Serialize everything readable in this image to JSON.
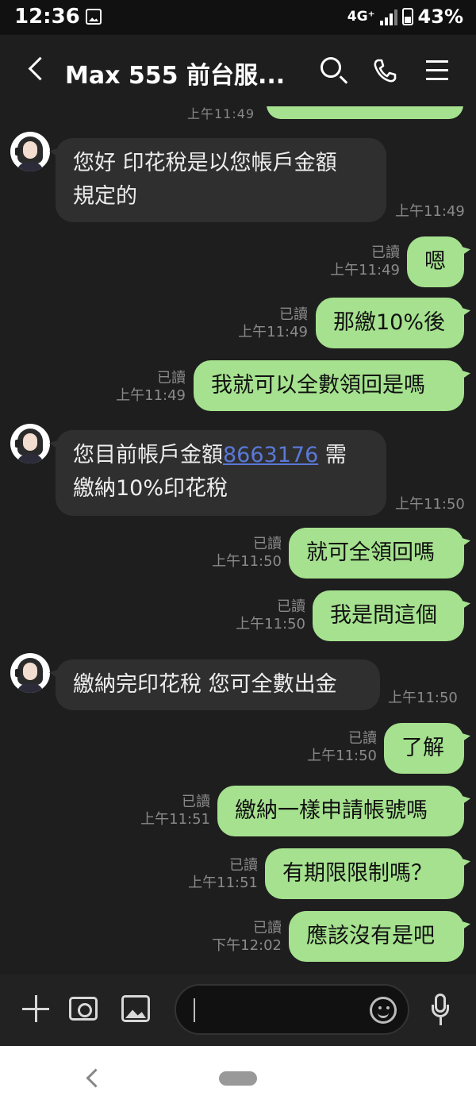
{
  "status_bar": {
    "time": "12:36",
    "network": "4G⁺",
    "battery": "43%"
  },
  "header": {
    "title": "Max 555 前台服..."
  },
  "messages": [
    {
      "id": "m1",
      "direction": "in",
      "lines": [
        "您好 印花稅是以您帳戶金額",
        "規定的"
      ],
      "time": "上午11:49"
    },
    {
      "id": "m2",
      "direction": "out",
      "text": "嗯",
      "read": "已讀",
      "time": "上午11:49"
    },
    {
      "id": "m3",
      "direction": "out",
      "text": "那繳10%後",
      "read": "已讀",
      "time": "上午11:49"
    },
    {
      "id": "m4",
      "direction": "out",
      "text": "我就可以全數領回是嗎",
      "read": "已讀",
      "time": "上午11:49"
    },
    {
      "id": "m5",
      "direction": "in",
      "line1_prefix": "您目前帳戶金額",
      "line1_link": "8663176",
      "line1_suffix": " 需",
      "line2": "繳納10%印花稅",
      "time": "上午11:50"
    },
    {
      "id": "m6",
      "direction": "out",
      "text": "就可全領回嗎",
      "read": "已讀",
      "time": "上午11:50"
    },
    {
      "id": "m7",
      "direction": "out",
      "text": "我是問這個",
      "read": "已讀",
      "time": "上午11:50"
    },
    {
      "id": "m8",
      "direction": "in",
      "text": "繳納完印花稅 您可全數出金",
      "time": "上午11:50"
    },
    {
      "id": "m9",
      "direction": "out",
      "text": "了解",
      "read": "已讀",
      "time": "上午11:50"
    },
    {
      "id": "m10",
      "direction": "out",
      "text": "繳納一樣申請帳號嗎",
      "read": "已讀",
      "time": "上午11:51"
    },
    {
      "id": "m11",
      "direction": "out",
      "text": "有期限限制嗎？",
      "read": "已讀",
      "time": "上午11:51"
    },
    {
      "id": "m12",
      "direction": "out",
      "text": "應該沒有是吧",
      "read": "已讀",
      "time": "下午12:02"
    }
  ],
  "partial_top": {
    "time": "上午11:49"
  },
  "colors": {
    "background": "#1e1e1e",
    "incoming_bubble": "#2f2f2f",
    "outgoing_bubble": "#a5e18e",
    "link": "#5a78d8"
  }
}
